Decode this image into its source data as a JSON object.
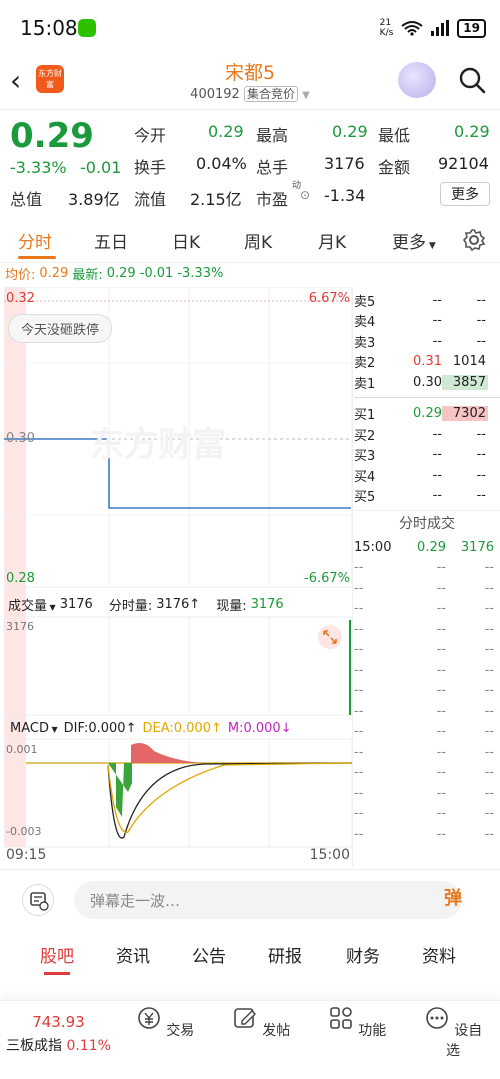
{
  "status_bar": {
    "time": "15:08",
    "speed": "21\nK/s",
    "battery": "19"
  },
  "header": {
    "logo_text": "东方财富",
    "stock_name": "宋都5",
    "stock_code": "400192",
    "stock_tag": "集合竞价"
  },
  "quote": {
    "price": "0.29",
    "change_pct": "-3.33%",
    "change_abs": "-0.01",
    "open_label": "今开",
    "open": "0.29",
    "high_label": "最高",
    "high": "0.29",
    "low_label": "最低",
    "low": "0.29",
    "turnover_label": "换手",
    "turnover": "0.04%",
    "volume_label": "总手",
    "volume": "3176",
    "amount_label": "金额",
    "amount": "92104",
    "mcap_label": "总值",
    "mcap": "3.89亿",
    "float_label": "流值",
    "float": "2.15亿",
    "pe_label": "市盈",
    "pe_sup": "动",
    "pe": "-1.34",
    "more": "更多"
  },
  "tabs": [
    "分时",
    "五日",
    "日K",
    "周K",
    "月K",
    "更多"
  ],
  "avg_line": {
    "avg_label": "均价:",
    "avg": "0.29",
    "latest_label": "最新:",
    "latest": "0.29",
    "chg": "-0.01",
    "pct": "-3.33%"
  },
  "chart": {
    "top_price": "0.32",
    "top_pct": "6.67%",
    "mid_price": "0.30",
    "bottom_price": "0.28",
    "bottom_pct": "-6.67%",
    "limit_pill": "今天没砸跌停",
    "watermark": "东方财富",
    "vol_label": "成交量",
    "vol": "3176",
    "minute_vol_label": "分时量:",
    "minute_vol": "3176↑",
    "cur_vol_label": "现量:",
    "cur_vol": "3176",
    "vol_axis": "3176",
    "macd_label": "MACD",
    "dif": "DIF:0.000↑",
    "dea": "DEA:0.000↑",
    "m": "M:0.000↓",
    "macd_top": "0.001",
    "macd_bottom": "-0.003",
    "time_start": "09:15",
    "time_end": "15:00"
  },
  "chart_data": {
    "type": "line",
    "x": [
      "09:15",
      "09:25",
      "15:00"
    ],
    "series": [
      {
        "values": [
          0.3,
          0.29,
          0.29
        ]
      }
    ],
    "ylim": [
      0.28,
      0.32
    ]
  },
  "order_book": {
    "asks": [
      {
        "label": "卖5",
        "price": "--",
        "vol": "--"
      },
      {
        "label": "卖4",
        "price": "--",
        "vol": "--"
      },
      {
        "label": "卖3",
        "price": "--",
        "vol": "--"
      },
      {
        "label": "卖2",
        "price": "0.31",
        "vol": "1014"
      },
      {
        "label": "卖1",
        "price": "0.30",
        "vol": "3857"
      }
    ],
    "bids": [
      {
        "label": "买1",
        "price": "0.29",
        "vol": "7302"
      },
      {
        "label": "买2",
        "price": "--",
        "vol": "--"
      },
      {
        "label": "买3",
        "price": "--",
        "vol": "--"
      },
      {
        "label": "买4",
        "price": "--",
        "vol": "--"
      },
      {
        "label": "买5",
        "price": "--",
        "vol": "--"
      }
    ],
    "trades_title": "分时成交",
    "trade": {
      "time": "15:00",
      "price": "0.29",
      "vol": "3176"
    },
    "empty": "--"
  },
  "danmu": {
    "placeholder": "弹幕走一波…",
    "button": "弹"
  },
  "bottom_tabs": [
    "股吧",
    "资讯",
    "公告",
    "研报",
    "财务",
    "资料"
  ],
  "nav": {
    "index_value": "743.93",
    "index_name": "三板成指",
    "index_pct": "0.11%",
    "items": [
      "交易",
      "发帖",
      "功能",
      "设自选"
    ]
  }
}
